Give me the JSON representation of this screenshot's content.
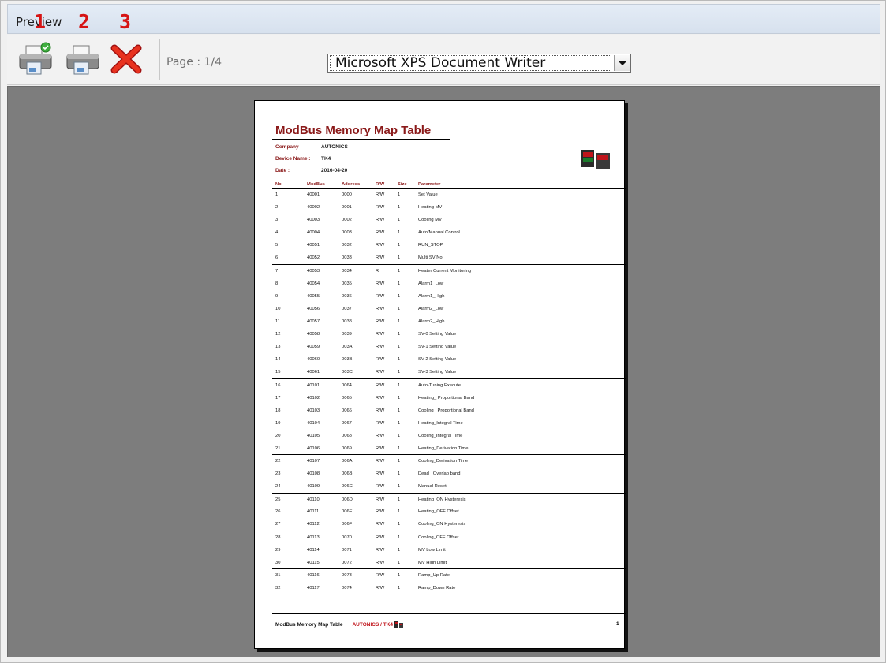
{
  "window": {
    "title": "Preview"
  },
  "annotations": [
    "1",
    "2",
    "3"
  ],
  "toolbar": {
    "print_preview_icon": "printer-check-icon",
    "print_icon": "printer-icon",
    "close_icon": "close-icon",
    "page_label": "Page : 1/4",
    "printer": "Microsoft XPS Document Writer"
  },
  "document": {
    "title": "ModBus Memory Map Table",
    "info": [
      {
        "key": "Company :",
        "value": "AUTONICS"
      },
      {
        "key": "Device Name :",
        "value": "TK4"
      },
      {
        "key": "Date :",
        "value": "2016-04-20"
      }
    ],
    "columns": [
      "No",
      "ModBus",
      "Address",
      "R/W",
      "Size",
      "Parameter"
    ],
    "rows": [
      [
        "1",
        "40001",
        "0000",
        "R/W",
        "1",
        "Set Value"
      ],
      [
        "2",
        "40002",
        "0001",
        "R/W",
        "1",
        "Heating MV"
      ],
      [
        "3",
        "40003",
        "0002",
        "R/W",
        "1",
        "Cooling MV"
      ],
      [
        "4",
        "40004",
        "0003",
        "R/W",
        "1",
        "Auto/Manual Control"
      ],
      [
        "5",
        "40051",
        "0032",
        "R/W",
        "1",
        "RUN_STOP"
      ],
      [
        "6",
        "40052",
        "0033",
        "R/W",
        "1",
        "Multi SV No"
      ],
      [
        "7",
        "40053",
        "0034",
        "R",
        "1",
        "Heater Current Monitoring"
      ],
      [
        "8",
        "40054",
        "0035",
        "R/W",
        "1",
        "Alarm1_Low"
      ],
      [
        "9",
        "40055",
        "0036",
        "R/W",
        "1",
        "Alarm1_High"
      ],
      [
        "10",
        "40056",
        "0037",
        "R/W",
        "1",
        "Alarm2_Low"
      ],
      [
        "11",
        "40057",
        "0038",
        "R/W",
        "1",
        "Alarm2_High"
      ],
      [
        "12",
        "40058",
        "0039",
        "R/W",
        "1",
        "SV-0 Setting Value"
      ],
      [
        "13",
        "40059",
        "003A",
        "R/W",
        "1",
        "SV-1 Setting Value"
      ],
      [
        "14",
        "40060",
        "003B",
        "R/W",
        "1",
        "SV-2 Setting Value"
      ],
      [
        "15",
        "40061",
        "003C",
        "R/W",
        "1",
        "SV-3 Setting Value"
      ],
      [
        "16",
        "40101",
        "0064",
        "R/W",
        "1",
        "Auto-Tuning Execute"
      ],
      [
        "17",
        "40102",
        "0065",
        "R/W",
        "1",
        "Heating_ Proportional Band"
      ],
      [
        "18",
        "40103",
        "0066",
        "R/W",
        "1",
        "Cooling_ Proportional Band"
      ],
      [
        "19",
        "40104",
        "0067",
        "R/W",
        "1",
        "Heating_Integral Time"
      ],
      [
        "20",
        "40105",
        "0068",
        "R/W",
        "1",
        "Cooling_Integral Time"
      ],
      [
        "21",
        "40106",
        "0069",
        "R/W",
        "1",
        "Heating_Derivation Time"
      ],
      [
        "22",
        "40107",
        "006A",
        "R/W",
        "1",
        "Cooling_Derivation Time"
      ],
      [
        "23",
        "40108",
        "006B",
        "R/W",
        "1",
        "Dead_ Overlap band"
      ],
      [
        "24",
        "40109",
        "006C",
        "R/W",
        "1",
        "Manual Reset"
      ],
      [
        "25",
        "40110",
        "006D",
        "R/W",
        "1",
        "Heating_ON Hysteresis"
      ],
      [
        "26",
        "40111",
        "006E",
        "R/W",
        "1",
        "Heating_OFF Offset"
      ],
      [
        "27",
        "40112",
        "006F",
        "R/W",
        "1",
        "Cooling_ON Hysteresis"
      ],
      [
        "28",
        "40113",
        "0070",
        "R/W",
        "1",
        "Cooling_OFF Offset"
      ],
      [
        "29",
        "40114",
        "0071",
        "R/W",
        "1",
        "MV Low Limit"
      ],
      [
        "30",
        "40115",
        "0072",
        "R/W",
        "1",
        "MV High Limit"
      ],
      [
        "31",
        "40116",
        "0073",
        "R/W",
        "1",
        "Ramp_Up Rate"
      ],
      [
        "32",
        "40117",
        "0074",
        "R/W",
        "1",
        "Ramp_Down Rate"
      ]
    ],
    "group_starts": [
      1,
      7,
      8,
      16,
      22,
      25,
      31
    ],
    "footer": {
      "left": "ModBus Memory Map Table",
      "brand": "AUTONICS / TK4",
      "page": "1"
    }
  }
}
